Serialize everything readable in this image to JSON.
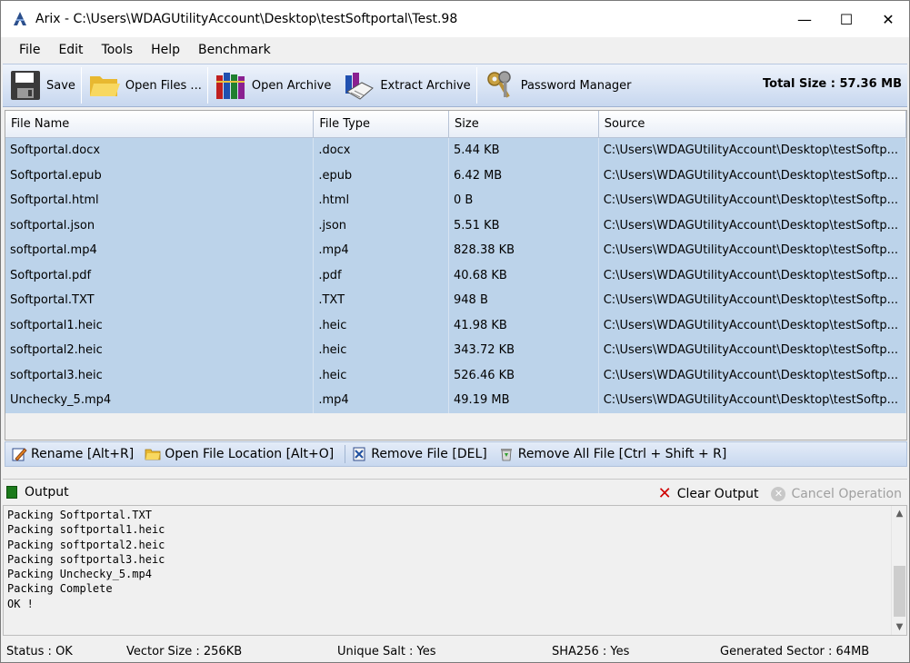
{
  "window": {
    "title": "Arix - C:\\Users\\WDAGUtilityAccount\\Desktop\\testSoftportal\\Test.98",
    "minimize": "—",
    "maximize": "☐",
    "close": "✕"
  },
  "menu": [
    "File",
    "Edit",
    "Tools",
    "Help",
    "Benchmark"
  ],
  "toolbar": {
    "save": "Save",
    "open_files": "Open Files ...",
    "open_archive": "Open Archive",
    "extract_archive": "Extract Archive",
    "password_manager": "Password Manager",
    "total_size": "Total Size : 57.36 MB"
  },
  "table": {
    "headers": [
      "File Name",
      "File Type",
      "Size",
      "Source"
    ],
    "rows": [
      [
        "Softportal.docx",
        ".docx",
        "5.44 KB",
        "C:\\Users\\WDAGUtilityAccount\\Desktop\\testSoftp..."
      ],
      [
        "Softportal.epub",
        ".epub",
        "6.42 MB",
        "C:\\Users\\WDAGUtilityAccount\\Desktop\\testSoftp..."
      ],
      [
        "Softportal.html",
        ".html",
        "0 B",
        "C:\\Users\\WDAGUtilityAccount\\Desktop\\testSoftp..."
      ],
      [
        "softportal.json",
        ".json",
        "5.51 KB",
        "C:\\Users\\WDAGUtilityAccount\\Desktop\\testSoftp..."
      ],
      [
        "softportal.mp4",
        ".mp4",
        "828.38 KB",
        "C:\\Users\\WDAGUtilityAccount\\Desktop\\testSoftp..."
      ],
      [
        "Softportal.pdf",
        ".pdf",
        "40.68 KB",
        "C:\\Users\\WDAGUtilityAccount\\Desktop\\testSoftp..."
      ],
      [
        "Softportal.TXT",
        ".TXT",
        "948 B",
        "C:\\Users\\WDAGUtilityAccount\\Desktop\\testSoftp..."
      ],
      [
        "softportal1.heic",
        ".heic",
        "41.98 KB",
        "C:\\Users\\WDAGUtilityAccount\\Desktop\\testSoftp..."
      ],
      [
        "softportal2.heic",
        ".heic",
        "343.72 KB",
        "C:\\Users\\WDAGUtilityAccount\\Desktop\\testSoftp..."
      ],
      [
        "softportal3.heic",
        ".heic",
        "526.46 KB",
        "C:\\Users\\WDAGUtilityAccount\\Desktop\\testSoftp..."
      ],
      [
        "Unchecky_5.mp4",
        ".mp4",
        "49.19 MB",
        "C:\\Users\\WDAGUtilityAccount\\Desktop\\testSoftp..."
      ]
    ]
  },
  "actions": {
    "rename": "Rename [Alt+R]",
    "open_location": "Open File Location [Alt+O]",
    "remove_file": "Remove File [DEL]",
    "remove_all": "Remove All File [Ctrl + Shift + R]"
  },
  "output": {
    "title": "Output",
    "clear": "Clear Output",
    "cancel": "Cancel Operation",
    "lines": [
      "Packing Softportal.TXT",
      "Packing softportal1.heic",
      "Packing softportal2.heic",
      "Packing softportal3.heic",
      "Packing Unchecky_5.mp4",
      "Packing Complete",
      "OK !"
    ]
  },
  "status": {
    "status": "Status :  OK",
    "vector": "Vector Size : 256KB",
    "salt": "Unique Salt : Yes",
    "sha": "SHA256 : Yes",
    "sector": "Generated Sector : 64MB"
  }
}
